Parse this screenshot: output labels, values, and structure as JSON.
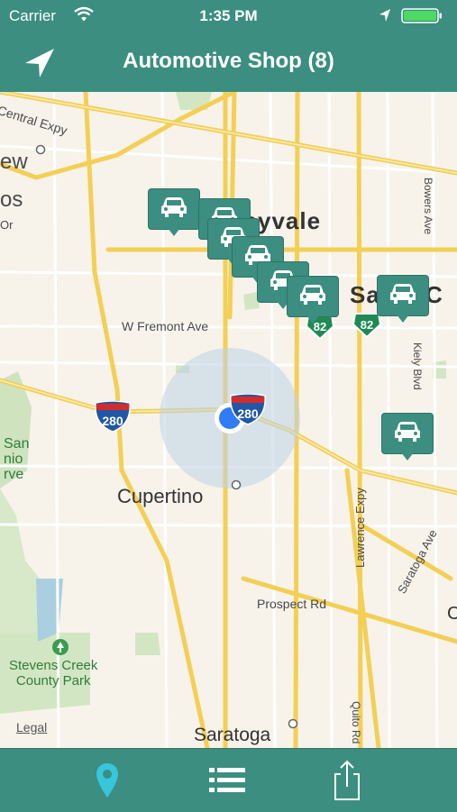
{
  "status_bar": {
    "carrier": "Carrier",
    "time": "1:35 PM"
  },
  "header": {
    "title": "Automotive Shop (8)"
  },
  "map": {
    "labels": {
      "central_expy": "Central Expy",
      "ew": "ew",
      "os": "os",
      "or": "Or",
      "sunnyvale": "Sunnyvale",
      "santa_clara": "Santa C",
      "w_fremont": "W Fremont Ave",
      "cupertino": "Cupertino",
      "san": "San",
      "nio": "nio",
      "rve": "rve",
      "stevens_creek": "Stevens Creek\nCounty Park",
      "prospect": "Prospect Rd",
      "saratoga": "Saratoga",
      "lawrence": "Lawrence Expy",
      "saratoga_ave": "Saratoga Ave",
      "quito": "Quito Rd",
      "kiely": "Kiely Blvd",
      "bowers": "Bowers Ave",
      "c_edge": "C"
    },
    "shields": {
      "i280_a": "280",
      "i280_b": "280",
      "ca82_a": "82",
      "ca82_b": "82"
    },
    "legal": "Legal",
    "pin_count": 8
  },
  "tabs": [
    {
      "name": "map-tab",
      "icon": "map-pin-icon",
      "active": true
    },
    {
      "name": "list-tab",
      "icon": "list-icon",
      "active": false
    },
    {
      "name": "share-tab",
      "icon": "share-icon",
      "active": false
    }
  ],
  "colors": {
    "brand": "#3b8e80",
    "active_tab": "#37c6dc",
    "user_dot": "#2f7cf6"
  }
}
